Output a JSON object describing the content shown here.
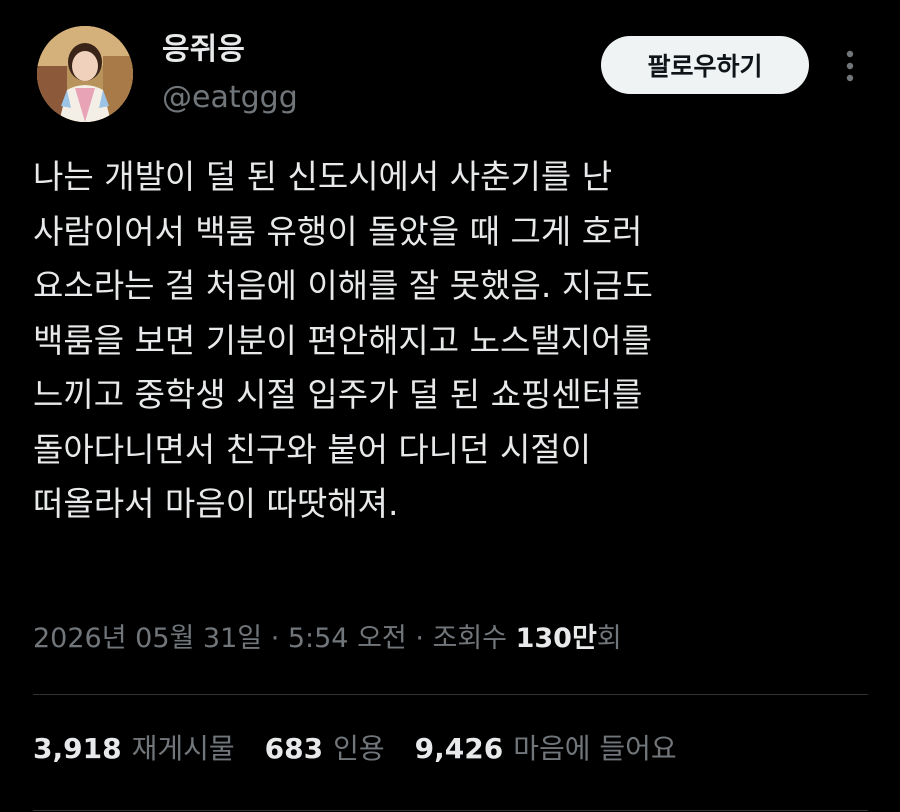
{
  "author": {
    "display_name": "응쥐응",
    "handle": "@eatggg"
  },
  "follow_button_label": "팔로우하기",
  "more_icon": "more-vertical-icon",
  "tweet": {
    "lines": [
      "나는 개발이 덜 된 신도시에서 사춘기를 난",
      "사람이어서 백룸 유행이 돌았을 때 그게 호러",
      "요소라는 걸 처음에 이해를 잘 못했음. 지금도",
      "백룸을 보면 기분이 편안해지고 노스탤지어를",
      "느끼고 중학생 시절 입주가 덜 된 쇼핑센터를",
      "돌아다니면서 친구와 붙어 다니던 시절이",
      "떠올라서 마음이 따땃해져."
    ]
  },
  "meta": {
    "timestamp": "2026년 05월 31일 · 5:54 오전 · 조회수 ",
    "views_number": "130만",
    "views_suffix": "회"
  },
  "stats": {
    "retweets": {
      "count": "3,918",
      "label": "재게시물"
    },
    "quotes": {
      "count": "683",
      "label": "인용"
    },
    "likes": {
      "count": "9,426",
      "label": "마음에 들어요"
    }
  },
  "colors": {
    "background": "#000000",
    "text_primary": "#e7e9ea",
    "text_secondary": "#71767b",
    "divider": "#2f3336",
    "follow_button_bg": "#eff3f4"
  }
}
